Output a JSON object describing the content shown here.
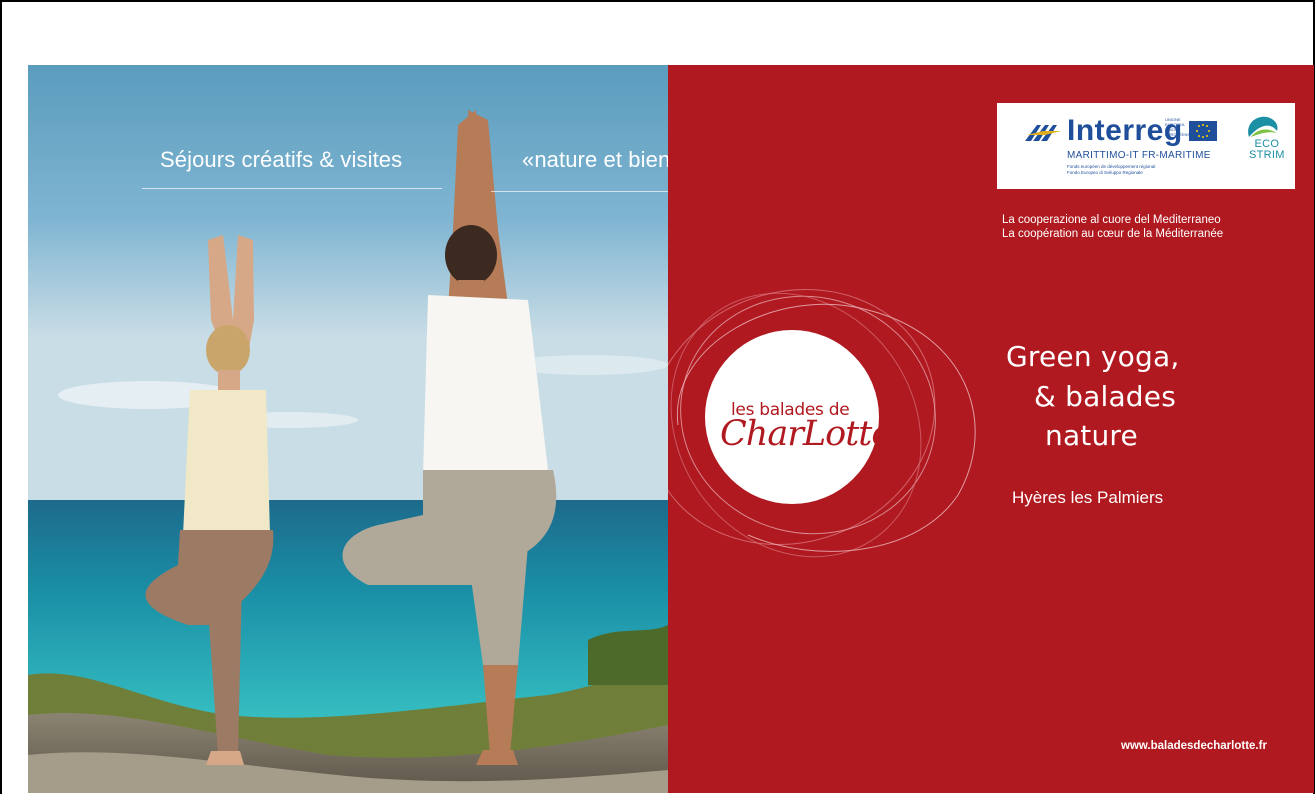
{
  "slide": {
    "headline_left": "Séjours créatifs & visites",
    "headline_right": "«nature et bien être»",
    "partner": {
      "interreg_name": "Interreg",
      "eu_fine_print": "UNIONE EUROPEA UNION EUROPÉENNE",
      "program": "MARITTIMO-IT FR-MARITIME",
      "fund_fr": "Fonds européen de développement régional",
      "fund_it": "Fondo Europeo di Sviluppo Regionale",
      "eco_top": "ECO",
      "eco_bottom": "STRIM"
    },
    "tagline_it": "La cooperazione al cuore del Mediterraneo",
    "tagline_fr": "La coopération au cœur de la Méditerranée",
    "logo": {
      "small_text": "les balades de",
      "script_text": "CharLotte"
    },
    "title_lines": [
      "Green yoga,",
      "& balades",
      "nature"
    ],
    "city": "Hyères les Palmiers",
    "website": "www.baladesdecharlotte.fr"
  },
  "colors": {
    "red_panel": "#b0191f",
    "interreg_blue": "#1f4e9b",
    "eco_teal": "#1b8fa3"
  },
  "icons": [
    "interreg-wings-icon",
    "eu-flag-icon",
    "ecostrim-wave-icon"
  ]
}
